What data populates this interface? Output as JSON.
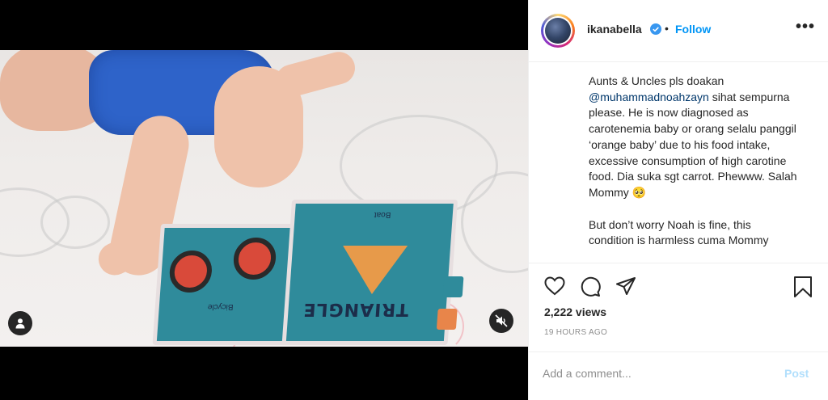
{
  "post": {
    "username": "ikanabella",
    "separator": "•",
    "follow_label": "Follow",
    "more_label": "•••",
    "caption": {
      "line1_prefix": "Aunts & Uncles pls doakan",
      "mention": "@muhammadnoahzayn",
      "line1_suffix": " sihat sempurna please. He is now diagnosed as carotenemia baby or orang selalu panggil ‘orange baby’ due to his food intake, excessive consumption of high carotine food. Dia suka sgt carrot. Phewww. Salah Mommy 🥺",
      "paragraph2": "But don’t worry Noah is fine, this condition is harmless cuma Mommy"
    },
    "views": "2,222 views",
    "timestamp": "19 HOURS AGO",
    "comment_placeholder": "Add a comment...",
    "post_label": "Post"
  },
  "video": {
    "book_title": "TRIANGLE",
    "book_label_1": "Boat",
    "book_label_2": "Bicycle"
  },
  "icons": {
    "like": "heart-icon",
    "comment": "comment-icon",
    "share": "share-icon",
    "save": "bookmark-icon",
    "user_tag": "user-icon",
    "mute": "muted-speaker-icon",
    "verified": "verified-badge-icon"
  },
  "colors": {
    "follow": "#0095f6",
    "verified": "#3897f0",
    "post_disabled": "#b2dffc",
    "mention": "#00376b"
  }
}
